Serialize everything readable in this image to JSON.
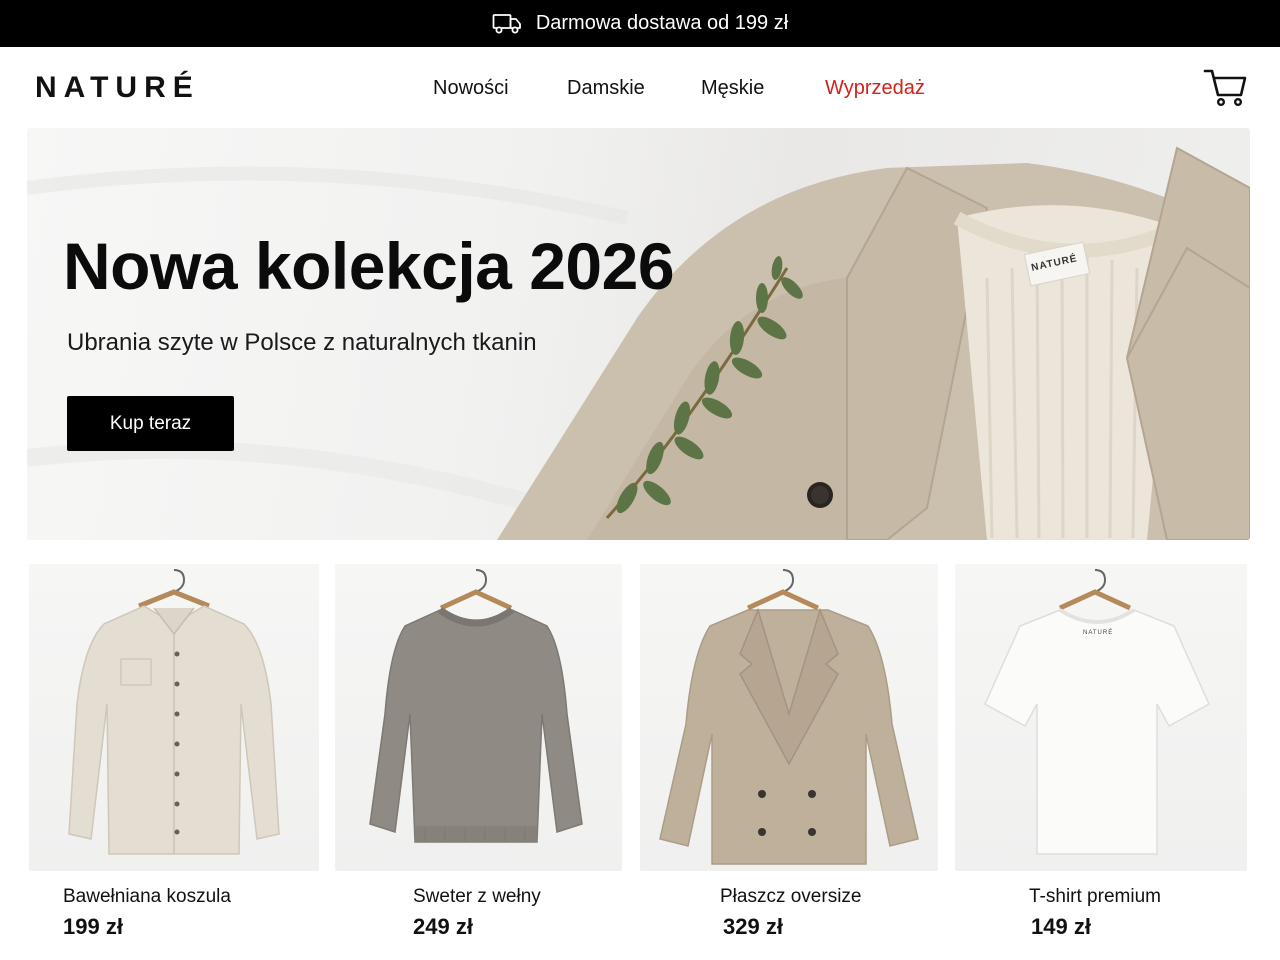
{
  "promo": {
    "text": "Darmowa dostawa od 199 zł",
    "icon": "truck-icon"
  },
  "header": {
    "logo": "NATURÉ",
    "nav": [
      "Nowości",
      "Damskie",
      "Męskie",
      "Wyprzedaż"
    ],
    "sale_color": "#d3211b",
    "cart_icon": "cart-icon"
  },
  "hero": {
    "title": "Nowa kolekcja 2026",
    "subtitle": "Ubrania szyte w Polsce z naturalnych tkanin",
    "cta": "Kup teraz",
    "label_text": "NATURÉ"
  },
  "products": [
    {
      "name": "Bawełniana koszula",
      "price": "199 zł"
    },
    {
      "name": "Sweter z wełny",
      "price": "249 zł"
    },
    {
      "name": "Płaszcz oversize",
      "price": "329 zł"
    },
    {
      "name": "T-shirt premium",
      "price": "149 zł",
      "tag_text": "NATURÉ"
    }
  ],
  "colors": {
    "accent": "#000000",
    "sale": "#d3211b",
    "coat": "#c9bba7",
    "sweater_grey": "#8f8a83"
  }
}
